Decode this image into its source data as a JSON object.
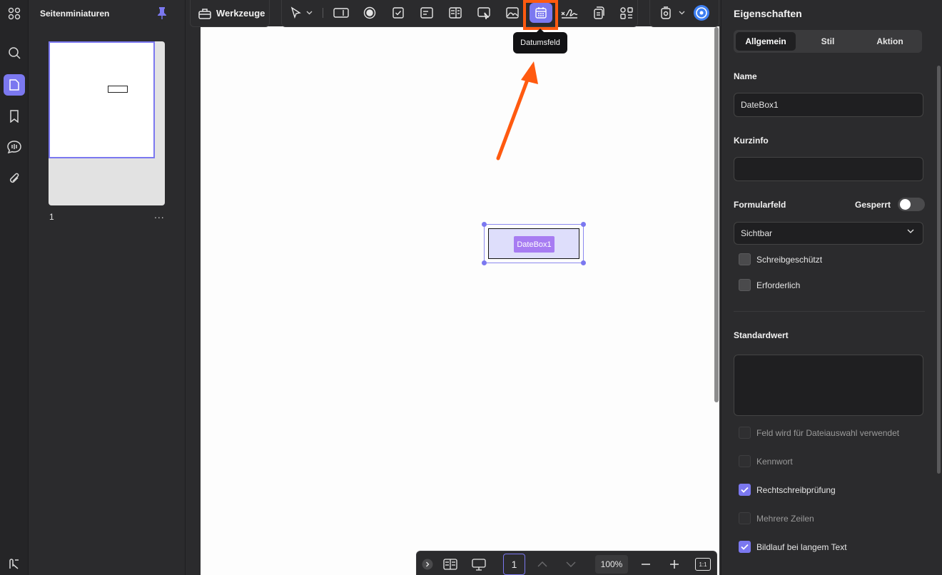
{
  "thumbnails": {
    "title": "Seitenminiaturen",
    "page_number": "1",
    "more_label": "..."
  },
  "toolbar": {
    "tools_label": "Werkzeuge",
    "tooltip": "Datumsfeld"
  },
  "document": {
    "field_name": "DateBox1"
  },
  "bottombar": {
    "page": "1",
    "zoom": "100%",
    "fit_label": "1:1"
  },
  "properties": {
    "title": "Eigenschaften",
    "tabs": [
      "Allgemein",
      "Stil",
      "Aktion"
    ],
    "active_tab": "Allgemein",
    "name_label": "Name",
    "name_value": "DateBox1",
    "tooltip_label": "Kurzinfo",
    "tooltip_value": "",
    "formfield_label": "Formularfeld",
    "locked_label": "Gesperrt",
    "locked": false,
    "visibility": "Sichtbar",
    "readonly_label": "Schreibgeschützt",
    "required_label": "Erforderlich",
    "default_label": "Standardwert",
    "options": [
      {
        "label": "Feld wird für Dateiauswahl verwendet",
        "checked": false,
        "enabled": false
      },
      {
        "label": "Kennwort",
        "checked": false,
        "enabled": false
      },
      {
        "label": "Rechtschreibprüfung",
        "checked": true,
        "enabled": true
      },
      {
        "label": "Mehrere Zeilen",
        "checked": false,
        "enabled": false
      },
      {
        "label": "Bildlauf bei langem Text",
        "checked": true,
        "enabled": true
      }
    ]
  },
  "colors": {
    "accent": "#7b78f0",
    "highlight": "#ff5a10",
    "field_tag": "#a77cf2"
  }
}
